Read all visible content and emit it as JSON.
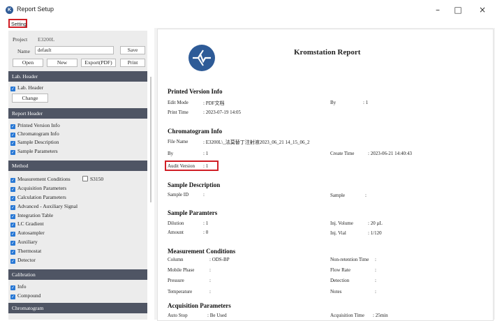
{
  "window": {
    "title": "Report Setup",
    "minimize": "–",
    "maximize": "□",
    "close": "×",
    "app_icon": "K"
  },
  "menu": {
    "setting": "Setting"
  },
  "sidebar": {
    "project_label": "Project",
    "project_value": "E3200L",
    "name_label": "Name",
    "name_value": "default",
    "buttons": {
      "save": "Save",
      "open": "Open",
      "new": "New",
      "export": "Export(PDF)",
      "print": "Print"
    },
    "lab_header": {
      "title": "Lab. Header",
      "item": "Lab. Header",
      "change": "Change"
    },
    "report_header": {
      "title": "Report Header",
      "items": [
        "Printed Version Info",
        "Chromatogram Info",
        "Sample Description",
        "Sample Parameters"
      ]
    },
    "method": {
      "title": "Method",
      "items": [
        "Measurement Conditions",
        "Acquisition Parameters",
        "Calculation Parameters",
        "Advanced - Auxiliary Signal",
        "Integration Table",
        "LC Gradient",
        "Autosampler",
        "Auxiliary",
        "Thermostat",
        "Detector"
      ],
      "extra": "S3150"
    },
    "calibration": {
      "title": "Calibration",
      "items": [
        "Info",
        "Compound"
      ]
    },
    "chromatogram": {
      "title": "Chromatogram"
    }
  },
  "report": {
    "title": "Kromstation Report",
    "printed": {
      "heading": "Printed Version Info",
      "edit_mode_label": "Edit Mode",
      "edit_mode_value": ":   PDF文档",
      "by_label": "By",
      "by_value": ":   1",
      "print_time_label": "Print Time",
      "print_time_value": ":   2023-07-19 14:05"
    },
    "chrom": {
      "heading": "Chromatogram Info",
      "file_label": "File Name",
      "file_value": ":   E3200L\\_法莫替丁注射液2023_06_21 14_15_06_2",
      "by_label": "By",
      "by_value": ":   1",
      "create_label": "Create Time",
      "create_value": ":   2023-06-21 14:40:43",
      "audit_label": "Audit Version",
      "audit_value": ":   1"
    },
    "sample_desc": {
      "heading": "Sample Description",
      "id_label": "Sample ID",
      "id_value": ":",
      "sample_label": "Sample",
      "sample_value": ":"
    },
    "sample_params": {
      "heading": "Sample Paramters",
      "dilution_label": "Dilution",
      "dilution_value": ":   1",
      "inj_vol_label": "Inj. Volume",
      "inj_vol_value": ":   20 µL",
      "amount_label": "Amount",
      "amount_value": ":   0",
      "vial_label": "Inj. Vial",
      "vial_value": ":   1/120"
    },
    "measure": {
      "heading": "Measurement Conditions",
      "column_label": "Column",
      "column_value": ":   ODS-BP",
      "nrt_label": "Non-retention Time",
      "nrt_value": ":",
      "mobile_label": "Mobile Phase",
      "mobile_value": ":",
      "flow_label": "Flow Rate",
      "flow_value": ":",
      "pressure_label": "Pressure",
      "pressure_value": ":",
      "detection_label": "Detection",
      "detection_value": ":",
      "temp_label": "Temperature",
      "temp_value": ":",
      "notes_label": "Notes",
      "notes_value": ":"
    },
    "acq": {
      "heading": "Acquisition Parameters",
      "autostop_label": "Auto Stop",
      "autostop_value": ":   Be Used",
      "acqtime_label": "Acquisition Time",
      "acqtime_value": ":   25min"
    }
  }
}
